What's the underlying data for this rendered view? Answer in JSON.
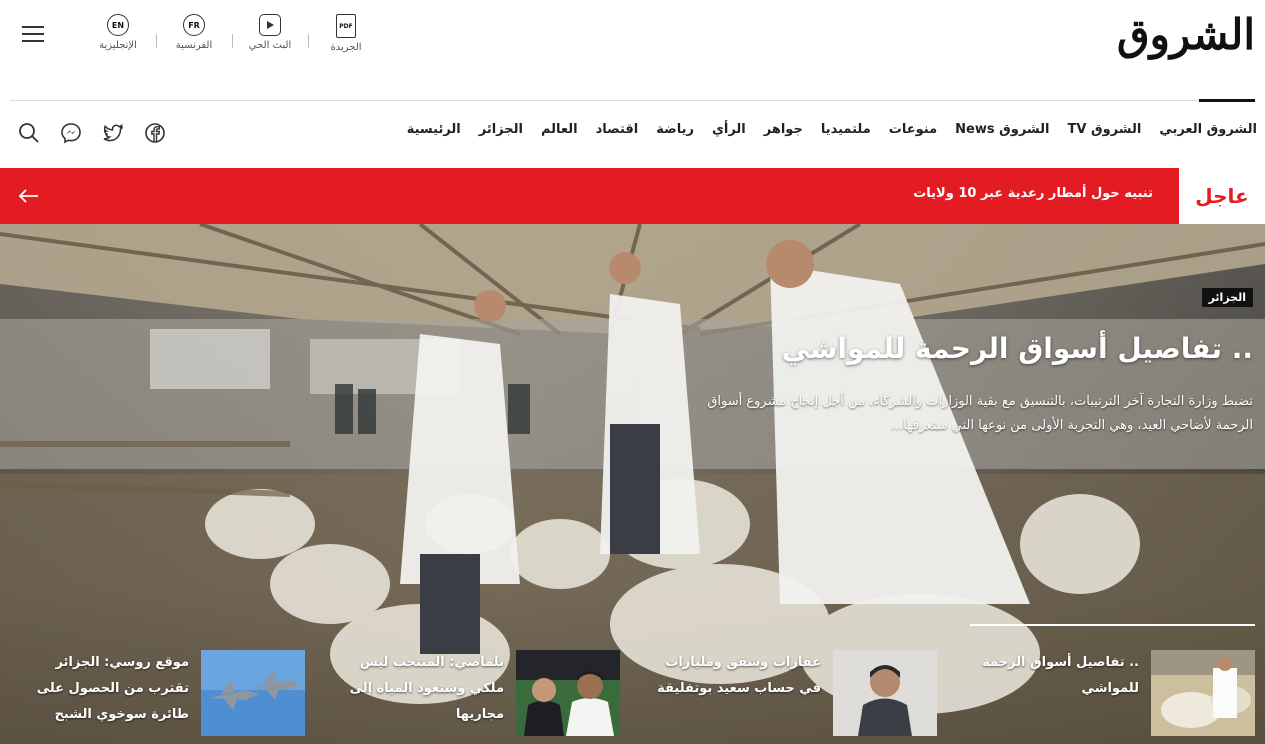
{
  "header": {
    "logo": "الشروق",
    "quick_links": [
      {
        "icon": "pdf-icon",
        "glyph": "PDF",
        "label": "الجريدة"
      },
      {
        "icon": "play-icon",
        "glyph": "",
        "label": "البث الحي"
      },
      {
        "icon": "fr-icon",
        "glyph": "FR",
        "label": "الفرنسية"
      },
      {
        "icon": "en-icon",
        "glyph": "EN",
        "label": "الإنجليزية"
      }
    ]
  },
  "nav": {
    "items": [
      "الرئيسية",
      "الجزائر",
      "العالم",
      "اقتصاد",
      "رياضة",
      "الرأي",
      "جواهر",
      "ملتميديا",
      "منوعات",
      "الشروق News",
      "الشروق TV",
      "الشروق العربي"
    ],
    "icons": [
      "facebook-icon",
      "twitter-icon",
      "messenger-icon",
      "search-icon"
    ]
  },
  "breaking": {
    "label": "عاجل",
    "text": "تنبيه حول أمطار رعدية عبر 10 ولايات"
  },
  "hero": {
    "category": "الجزائر",
    "title": ".. تفاصيل أسواق الرحمة للمواشي",
    "excerpt": "تضبط وزارة التجارة آخر الترتيبات، بالتنسيق مع بقية الوزارات والشركاء، من أجل إنجاح مشروع أسواق الرحمة لأضاحي العيد، وهي التجربة الأولى من نوعها التي ستعرفها..."
  },
  "related": [
    {
      "title": ".. تفاصيل أسواق الرحمة للمواشي",
      "thumb": "sheep-market-thumb"
    },
    {
      "title": "عقارات وشقق ومليارات في حساب سعيد بوتفليقة",
      "thumb": "man-portrait-thumb"
    },
    {
      "title": "بلماضي: المنتخب ليس ملكي وستعود المياه إلى مجاريها",
      "thumb": "players-thumb"
    },
    {
      "title": "موقع روسي: الجزائر تقترب من الحصول على طائرة سوخوي الشبح",
      "thumb": "jets-thumb"
    }
  ],
  "colors": {
    "brand_red": "#e31b23",
    "text": "#222222"
  }
}
